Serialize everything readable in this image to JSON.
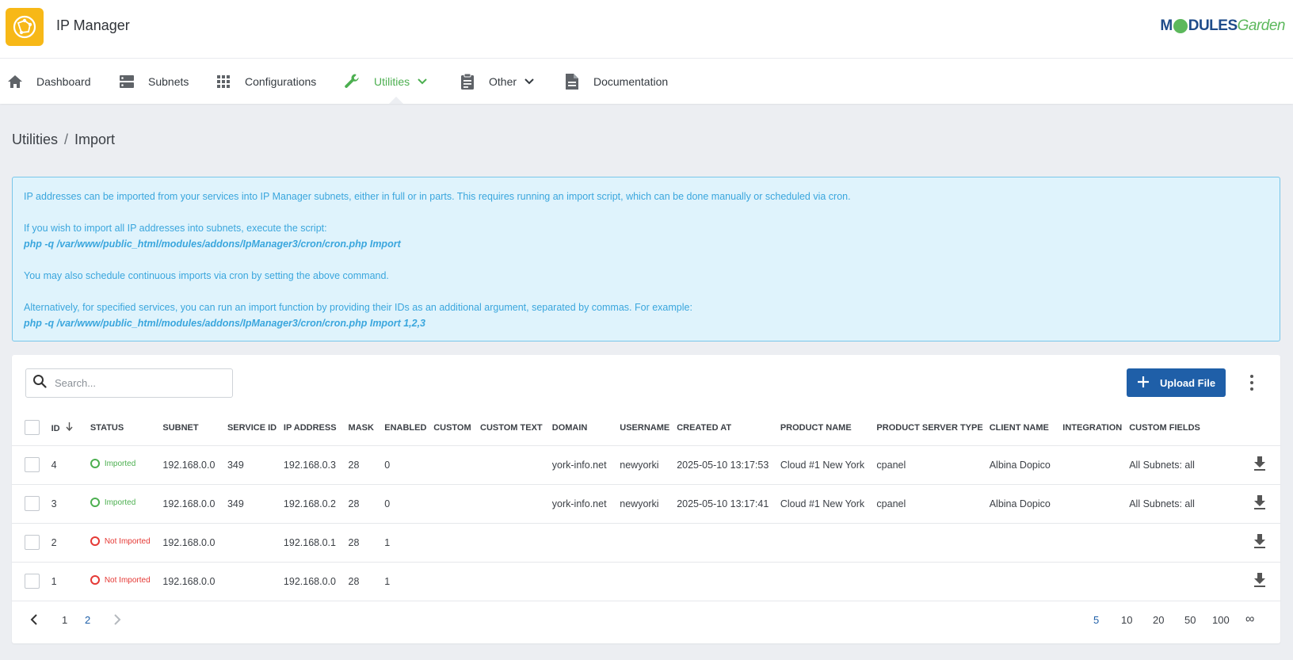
{
  "app": {
    "title": "IP Manager",
    "brand_left": "M",
    "brand_mid": "DULES",
    "brand_right": "Garden"
  },
  "nav": {
    "items": [
      {
        "label": "Dashboard"
      },
      {
        "label": "Subnets"
      },
      {
        "label": "Configurations"
      },
      {
        "label": "Utilities"
      },
      {
        "label": "Other"
      },
      {
        "label": "Documentation"
      }
    ],
    "active_color": "#4caf50"
  },
  "breadcrumb": {
    "parent": "Utilities",
    "separator": "/",
    "current": "Import"
  },
  "alert": {
    "line1": "IP addresses can be imported from your services into IP Manager subnets, either in full or in parts. This requires running an import script, which can be done manually or scheduled via cron.",
    "line2": "If you wish to import all IP addresses into subnets, execute the script:",
    "code1": "php -q /var/www/public_html/modules/addons/IpManager3/cron/cron.php Import",
    "line3": "You may also schedule continuous imports via cron by setting the above command.",
    "line4": "Alternatively, for specified services, you can run an import function by providing their IDs as an additional argument, separated by commas. For example:",
    "code2": "php -q /var/www/public_html/modules/addons/IpManager3/cron/cron.php Import 1,2,3"
  },
  "toolbar": {
    "search_placeholder": "Search...",
    "upload_label": "Upload File"
  },
  "table": {
    "headers": [
      "ID",
      "STATUS",
      "SUBNET",
      "SERVICE ID",
      "IP ADDRESS",
      "MASK",
      "ENABLED",
      "CUSTOM",
      "CUSTOM TEXT",
      "DOMAIN",
      "USERNAME",
      "CREATED AT",
      "PRODUCT NAME",
      "PRODUCT SERVER TYPE",
      "CLIENT NAME",
      "INTEGRATION",
      "CUSTOM FIELDS"
    ],
    "rows": [
      {
        "id": "4",
        "status": "Imported",
        "subnet": "192.168.0.0",
        "service_id": "349",
        "ip": "192.168.0.3",
        "mask": "28",
        "enabled": "0",
        "custom": "",
        "custom_text": "",
        "domain": "york-info.net",
        "username": "newyorki",
        "created_at": "2025-05-10 13:17:53",
        "product": "Cloud #1 New York",
        "server_type": "cpanel",
        "client": "Albina Dopico",
        "integration": "",
        "custom_fields": "All Subnets: all"
      },
      {
        "id": "3",
        "status": "Imported",
        "subnet": "192.168.0.0",
        "service_id": "349",
        "ip": "192.168.0.2",
        "mask": "28",
        "enabled": "0",
        "custom": "",
        "custom_text": "",
        "domain": "york-info.net",
        "username": "newyorki",
        "created_at": "2025-05-10 13:17:41",
        "product": "Cloud #1 New York",
        "server_type": "cpanel",
        "client": "Albina Dopico",
        "integration": "",
        "custom_fields": "All Subnets: all"
      },
      {
        "id": "2",
        "status": "Not Imported",
        "subnet": "192.168.0.0",
        "service_id": "",
        "ip": "192.168.0.1",
        "mask": "28",
        "enabled": "1",
        "custom": "",
        "custom_text": "",
        "domain": "",
        "username": "",
        "created_at": "",
        "product": "",
        "server_type": "",
        "client": "",
        "integration": "",
        "custom_fields": ""
      },
      {
        "id": "1",
        "status": "Not Imported",
        "subnet": "192.168.0.0",
        "service_id": "",
        "ip": "192.168.0.0",
        "mask": "28",
        "enabled": "1",
        "custom": "",
        "custom_text": "",
        "domain": "",
        "username": "",
        "created_at": "",
        "product": "",
        "server_type": "",
        "client": "",
        "integration": "",
        "custom_fields": ""
      }
    ]
  },
  "pagination": {
    "pages": [
      "1",
      "2"
    ],
    "active_page": "2",
    "per_page": [
      "5",
      "10",
      "20",
      "50",
      "100",
      "∞"
    ],
    "active_per_page": "5"
  },
  "colors": {
    "primary": "#1f5fa8",
    "success": "#4caf50",
    "danger": "#e53935",
    "info_text": "#3aa6dd",
    "logo_bg": "#f7b817"
  }
}
